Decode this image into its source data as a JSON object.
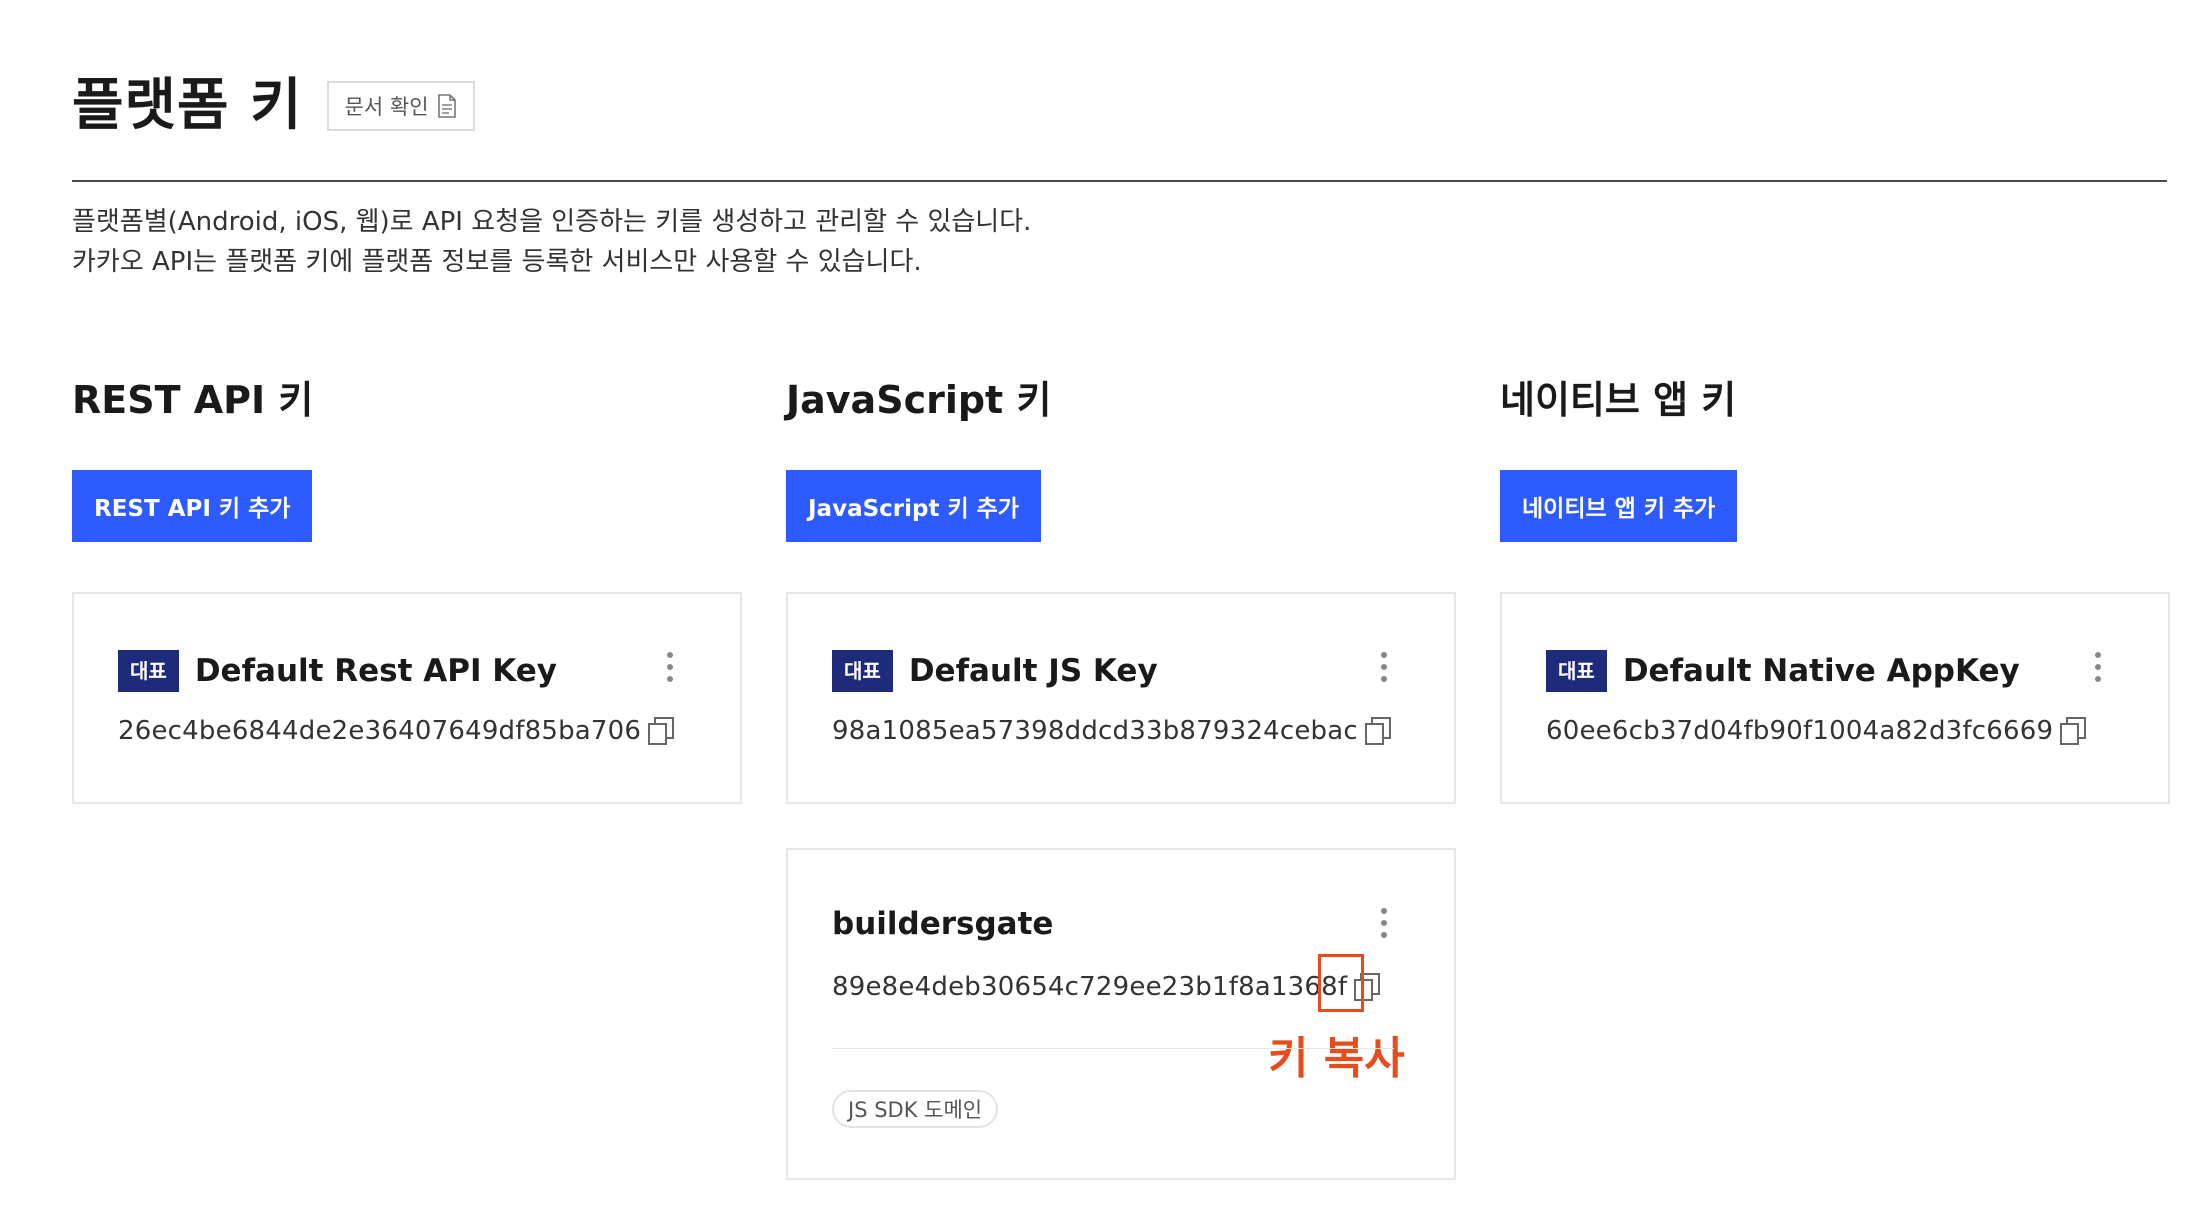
{
  "header": {
    "title": "플랫폼 키",
    "doc_button_label": "문서 확인"
  },
  "description": {
    "line1": "플랫폼별(Android, iOS, 웹)로 API 요청을 인증하는 키를 생성하고 관리할 수 있습니다.",
    "line2": "카카오 API는 플랫폼 키에 플랫폼 정보를 등록한 서비스만 사용할 수 있습니다."
  },
  "columns": {
    "rest": {
      "title": "REST API 키",
      "add_label": "REST API 키 추가",
      "cards": [
        {
          "badge": "대표",
          "name": "Default Rest API Key",
          "key": "26ec4be6844de2e36407649df85ba706"
        }
      ]
    },
    "js": {
      "title": "JavaScript 키",
      "add_label": "JavaScript 키 추가",
      "cards": [
        {
          "badge": "대표",
          "name": "Default JS Key",
          "key": "98a1085ea57398ddcd33b879324cebac"
        },
        {
          "name": "buildersgate",
          "key": "89e8e4deb30654c729ee23b1f8a1368f",
          "tag": "JS SDK 도메인"
        }
      ]
    },
    "native": {
      "title": "네이티브 앱 키",
      "add_label": "네이티브 앱 키 추가",
      "cards": [
        {
          "badge": "대표",
          "name": "Default Native AppKey",
          "key": "60ee6cb37d04fb90f1004a82d3fc6669"
        }
      ]
    }
  },
  "annotation": {
    "label": "키 복사",
    "color": "#e74b1e"
  },
  "colors": {
    "primary": "#2e5bff",
    "badge": "#1e2b7a",
    "border": "#e6e6e6"
  },
  "icons": {
    "doc": "document-icon",
    "copy": "copy-icon",
    "more": "more-vertical-icon"
  }
}
